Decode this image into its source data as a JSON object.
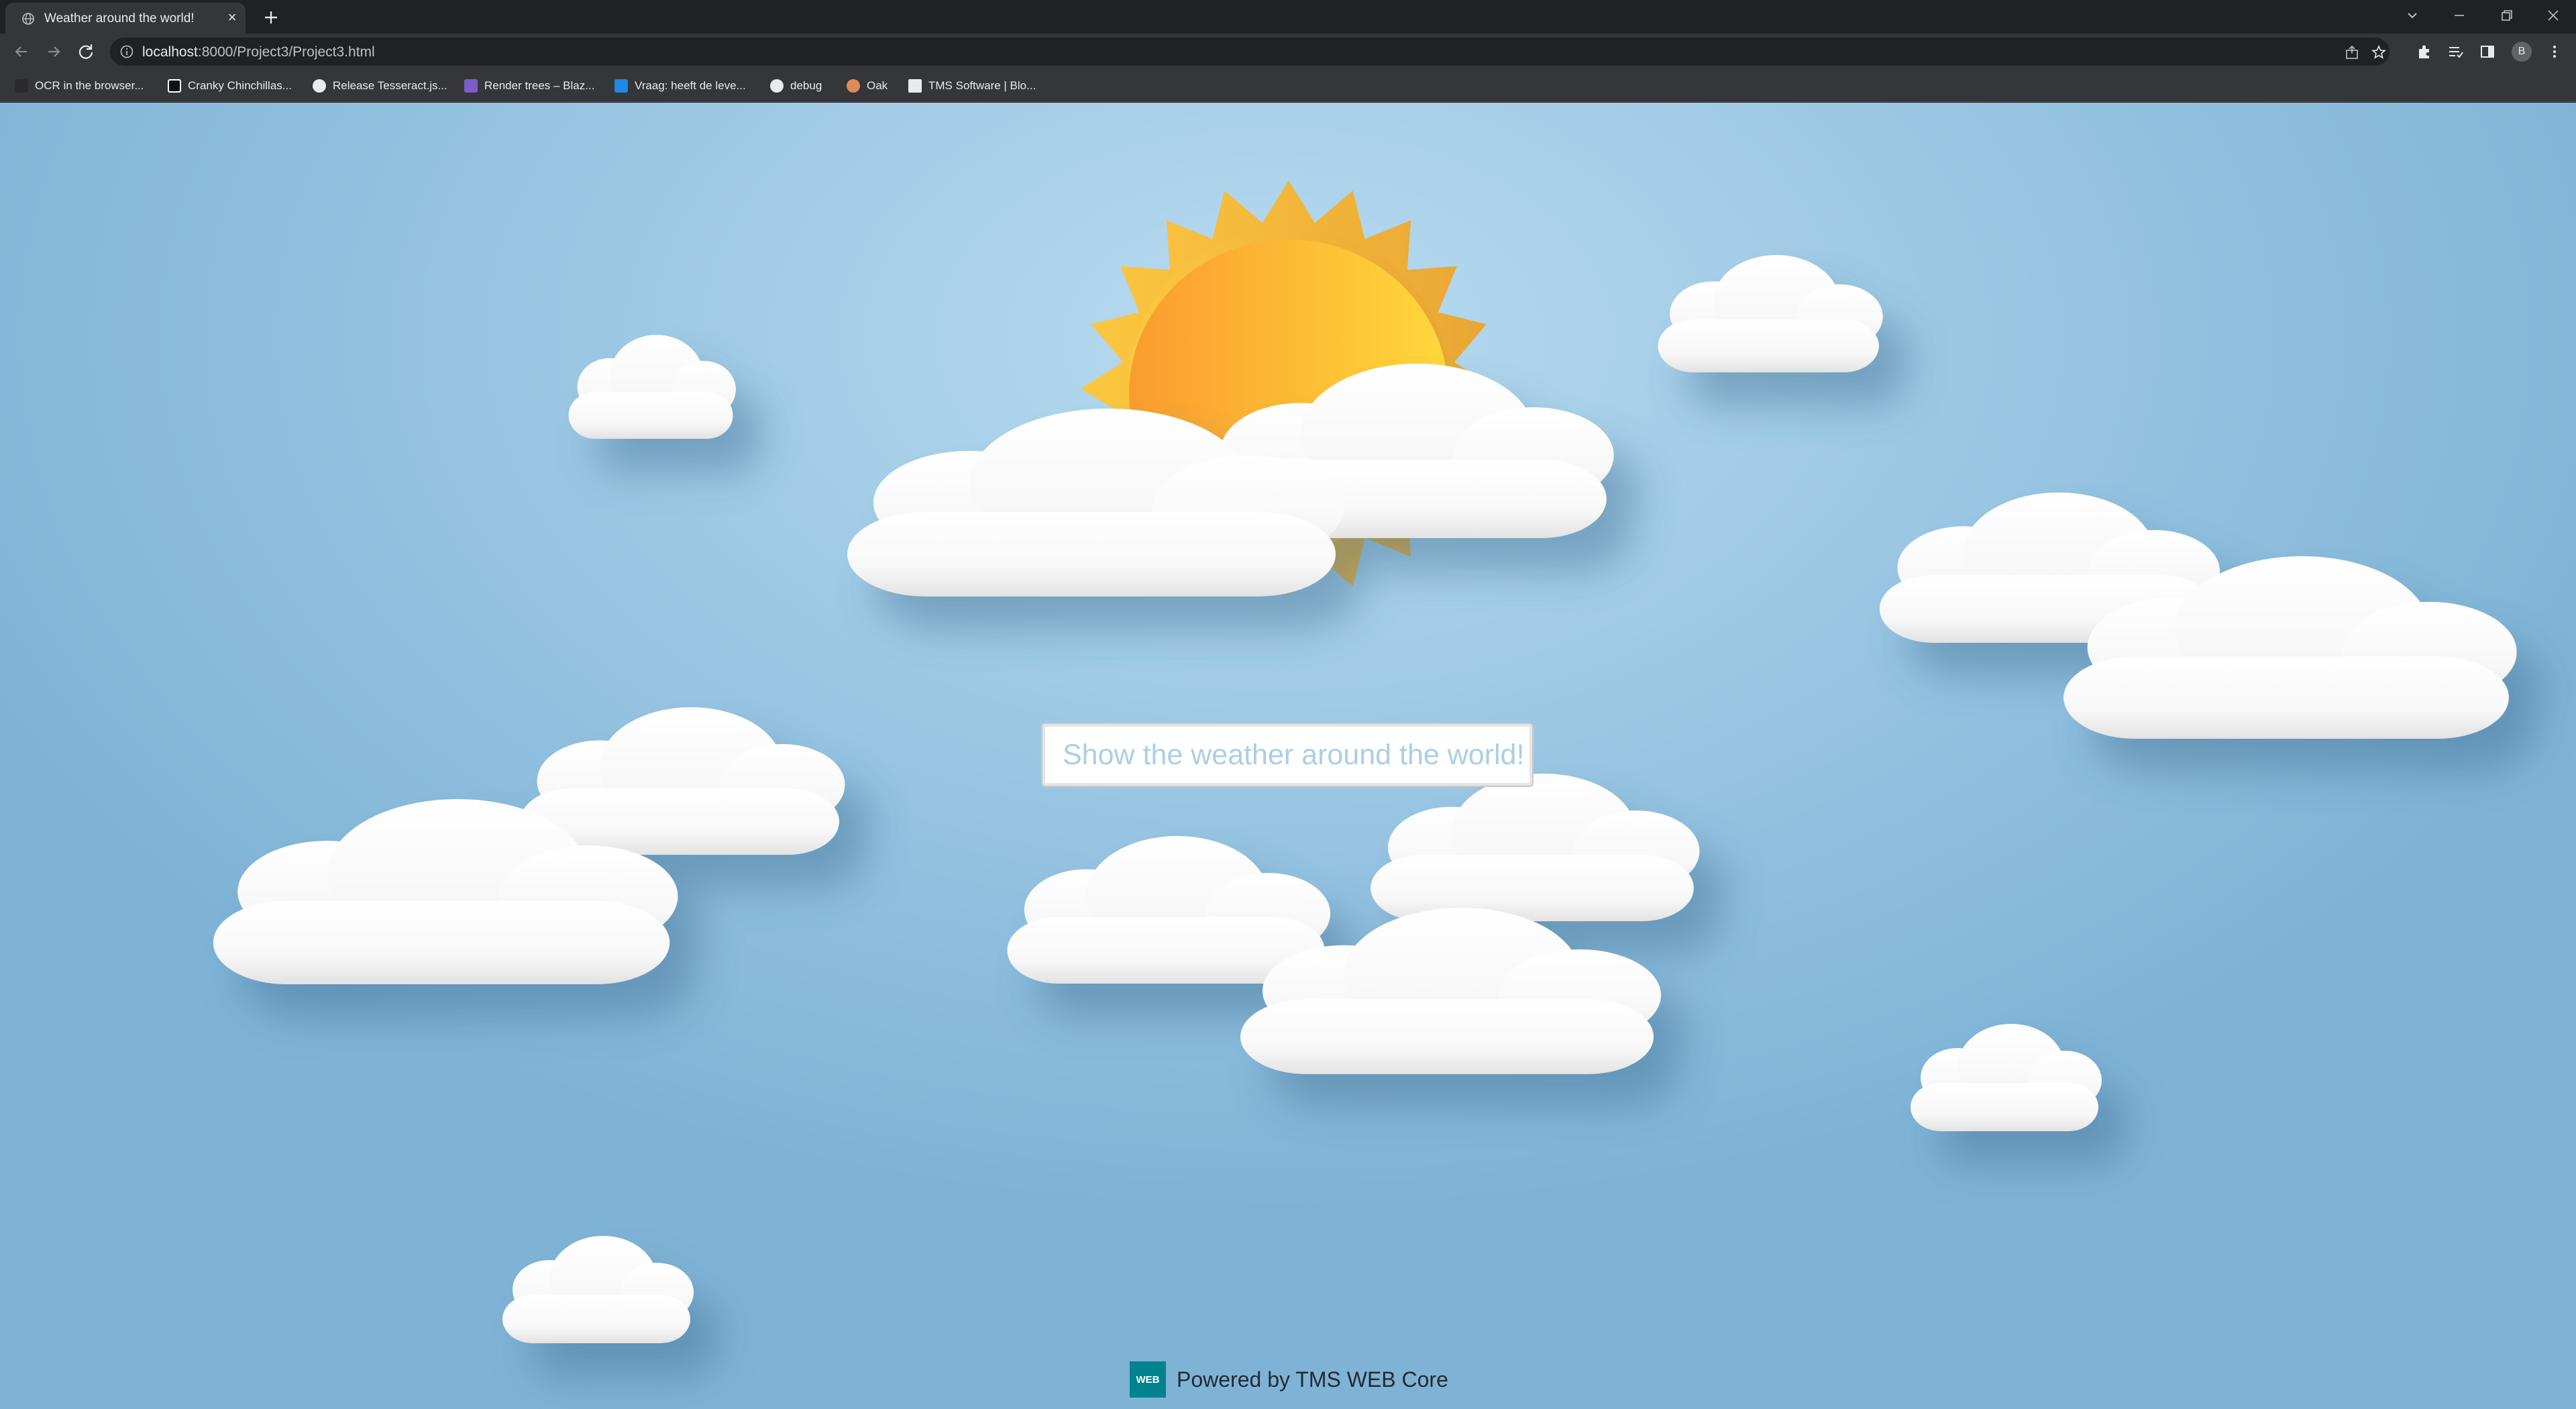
{
  "browser": {
    "tab": {
      "title": "Weather around the world!"
    },
    "address": {
      "host": "localhost",
      "path": ":8000/Project3/Project3.html"
    },
    "bookmarks": [
      {
        "label": "OCR in the browser...",
        "icon": "ocr-icon"
      },
      {
        "label": "Cranky Chinchillas...",
        "icon": "cranky-chinchillas-icon"
      },
      {
        "label": "Release Tesseract.js...",
        "icon": "github-icon"
      },
      {
        "label": "Render trees – Blaz...",
        "icon": "blazor-icon"
      },
      {
        "label": "Vraag: heeft de leve...",
        "icon": "vraag-icon"
      },
      {
        "label": "debug",
        "icon": "github-icon"
      },
      {
        "label": "Oak",
        "icon": "oak-icon"
      },
      {
        "label": "TMS Software | Blo...",
        "icon": "tms-icon"
      }
    ],
    "profile_initial": "B"
  },
  "page": {
    "search": {
      "placeholder": "Show the weather around the world!"
    },
    "footer": {
      "logo_text": "WEB",
      "text": "Powered by TMS WEB Core"
    }
  },
  "colors": {
    "sky": "#a7d0ea",
    "sun_outer": "#f6bd3a",
    "sun_inner": "#fb9f2f",
    "footer_logo": "#00838f"
  }
}
